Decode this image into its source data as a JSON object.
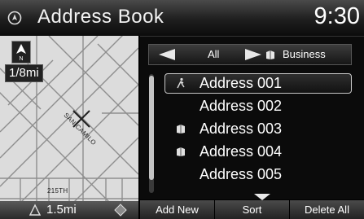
{
  "header": {
    "title": "Address Book",
    "clock": "9:30",
    "icon": "navigation-icon"
  },
  "map": {
    "scale_badge": "1/8mi",
    "zoom_scale": "1.5mi",
    "street_labels": [
      "SAN CAMILO",
      "215TH"
    ],
    "icons": [
      "north-arrow-icon",
      "zoom-out-icon",
      "zoom-in-icon"
    ]
  },
  "categories": {
    "prev": "All",
    "next": "Business",
    "next_icon": "business-icon"
  },
  "addresses": [
    {
      "label": "Address 001",
      "icon": "walking-icon",
      "selected": true
    },
    {
      "label": "Address 002",
      "icon": "",
      "selected": false
    },
    {
      "label": "Address 003",
      "icon": "business-icon",
      "selected": false
    },
    {
      "label": "Address 004",
      "icon": "business-icon",
      "selected": false
    },
    {
      "label": "Address 005",
      "icon": "",
      "selected": false
    }
  ],
  "bottom_buttons": {
    "add_new": "Add New",
    "sort": "Sort",
    "delete_all": "Delete All"
  }
}
